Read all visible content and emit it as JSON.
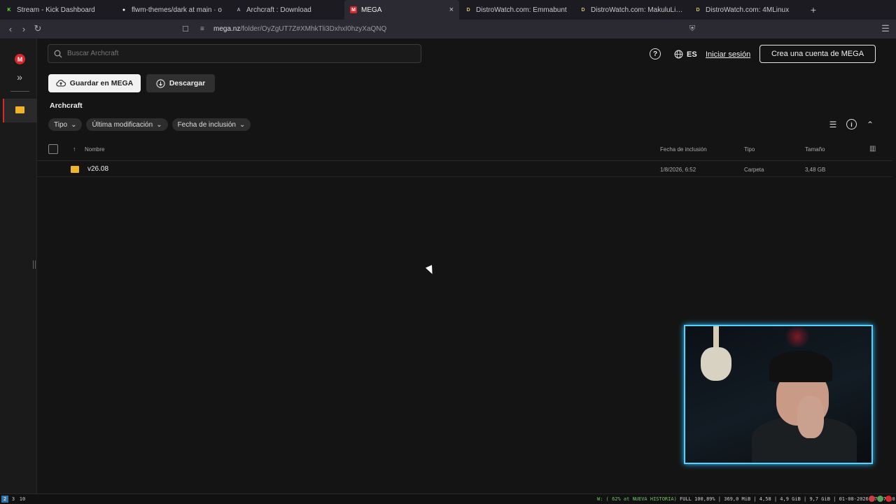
{
  "browser": {
    "tabs": [
      {
        "title": "Stream - Kick Dashboard",
        "icon": "kick-icon",
        "color": "#53fc18"
      },
      {
        "title": "flwm-themes/dark at main · o",
        "icon": "github-icon",
        "color": "#ffffff"
      },
      {
        "title": "Archcraft : Download",
        "icon": "archcraft-icon",
        "color": "#9aa7b0"
      },
      {
        "title": "MEGA",
        "icon": "mega-icon",
        "color": "#d9272e",
        "active": true
      },
      {
        "title": "DistroWatch.com: Emmabunt",
        "icon": "distrowatch-icon",
        "color": "#d8c46a"
      },
      {
        "title": "DistroWatch.com: MakuluLinu",
        "icon": "distrowatch-icon",
        "color": "#d8c46a"
      },
      {
        "title": "DistroWatch.com: 4MLinux",
        "icon": "distrowatch-icon",
        "color": "#d8c46a"
      }
    ],
    "url_host": "mega.nz",
    "url_path": "/folder/OyZgUT7Z#XMhkTli3DxhxI0hzyXaQNQ"
  },
  "header": {
    "search_placeholder": "Buscar Archcraft",
    "lang": "ES",
    "login": "Iniciar sesión",
    "signup": "Crea una cuenta de MEGA"
  },
  "toolbar": {
    "save_label": "Guardar en MEGA",
    "download_label": "Descargar"
  },
  "breadcrumb": "Archcraft",
  "filters": [
    "Tipo",
    "Última modificación",
    "Fecha de inclusión"
  ],
  "table": {
    "columns": {
      "name": "Nombre",
      "date": "Fecha de inclusión",
      "type": "Tipo",
      "size": "Tamaño"
    },
    "rows": [
      {
        "name": "v26.08",
        "date": "1/8/2026, 6:52",
        "type": "Carpeta",
        "size": "3,48 GB"
      }
    ]
  },
  "taskbar": {
    "workspaces": [
      "2",
      "3",
      "10"
    ],
    "status_green": "W: ( 62% at NUEVA HISTORIA)",
    "status_rest": " FULL 100,89% | 369,0 MiB | 4,58 | 4,9 GiB | 9,7 GiB | 01-08-2026 17:37:10 |"
  }
}
